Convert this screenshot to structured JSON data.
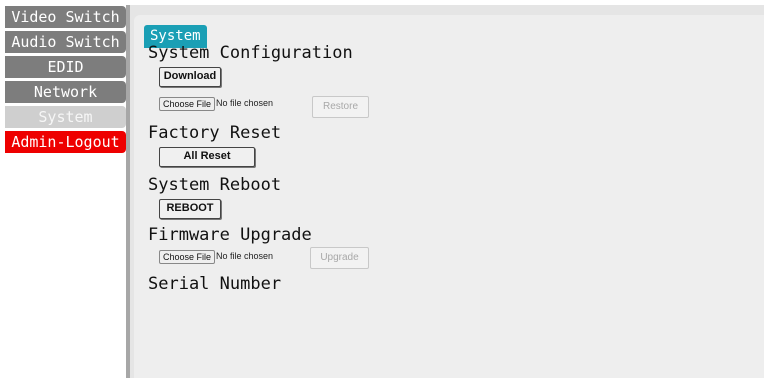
{
  "sidebar": {
    "items": [
      {
        "label": "Video Switch",
        "style": "gray"
      },
      {
        "label": "Audio Switch",
        "style": "gray"
      },
      {
        "label": "EDID",
        "style": "gray"
      },
      {
        "label": "Network",
        "style": "gray"
      },
      {
        "label": "System",
        "style": "active"
      },
      {
        "label": "Admin-Logout",
        "style": "logout"
      }
    ]
  },
  "tab": {
    "label": "System"
  },
  "sections": {
    "config": {
      "title": "System Configuration",
      "download_label": "Download",
      "choose_file_label": "Choose File",
      "file_status": "No file chosen",
      "restore_label": "Restore"
    },
    "factory": {
      "title": "Factory Reset",
      "all_reset_label": "All Reset"
    },
    "reboot": {
      "title": "System Reboot",
      "reboot_label": "REBOOT"
    },
    "firmware": {
      "title": "Firmware Upgrade",
      "choose_file_label": "Choose File",
      "file_status": "No file chosen",
      "upgrade_label": "Upgrade"
    },
    "serial": {
      "title": "Serial Number"
    }
  },
  "colors": {
    "tab": "#1a9fb5",
    "nav_gray": "#7d7d7d",
    "nav_active": "#cfcfcf",
    "logout": "#ee0000"
  }
}
